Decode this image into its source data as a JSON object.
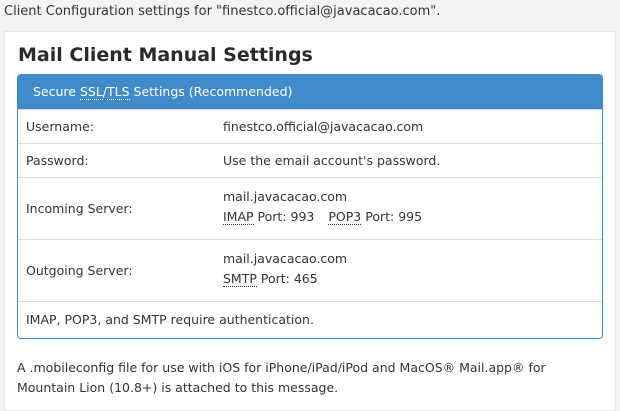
{
  "intro_text": "Client Configuration settings for \"finestco.official@javacacao.com\".",
  "heading": "Mail Client Manual Settings",
  "panel": {
    "header_prefix": "Secure ",
    "header_ssl": "SSL",
    "header_slash": "/",
    "header_tls": "TLS",
    "header_suffix": " Settings (Recommended)"
  },
  "rows": {
    "username": {
      "label": "Username:",
      "value": "finestco.official@javacacao.com"
    },
    "password": {
      "label": "Password:",
      "value": "Use the email account's password."
    },
    "incoming": {
      "label": "Incoming Server:",
      "host": "mail.javacacao.com",
      "imap_abbr": "IMAP",
      "imap_port_text": " Port: 993",
      "pop3_abbr": "POP3",
      "pop3_port_text": " Port: 995"
    },
    "outgoing": {
      "label": "Outgoing Server:",
      "host": "mail.javacacao.com",
      "smtp_abbr": "SMTP",
      "smtp_port_text": " Port: 465"
    },
    "auth_note": "IMAP, POP3, and SMTP require authentication."
  },
  "footer_text": "A .mobileconfig file for use with iOS for iPhone/iPad/iPod and MacOS® Mail.app® for Mountain Lion (10.8+) is attached to this message.",
  "colors": {
    "panel_header_bg": "#428bca",
    "panel_border": "#3a8bd0"
  }
}
